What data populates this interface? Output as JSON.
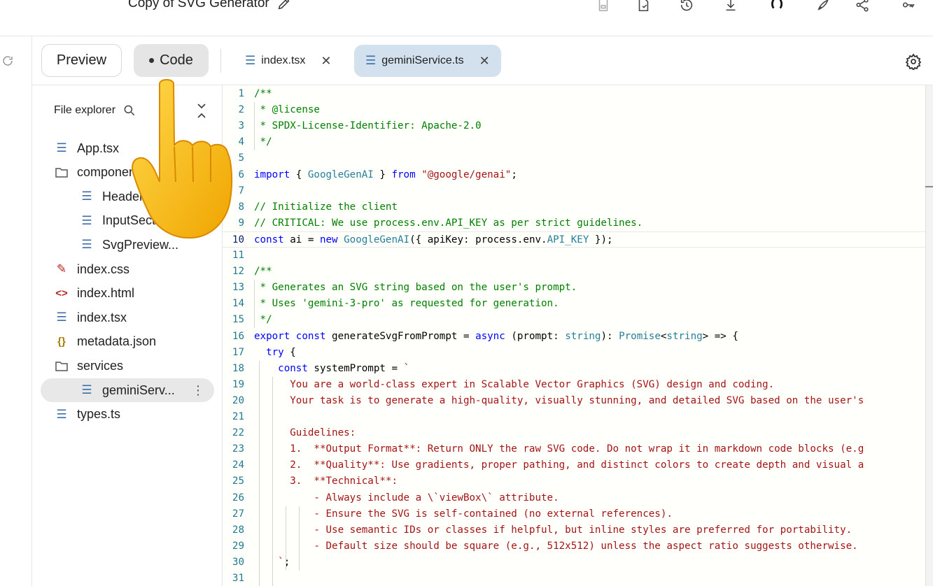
{
  "header": {
    "title": "Copy of SVG Generator",
    "icons": [
      "save-icon",
      "export-file-icon",
      "history-icon",
      "download-icon",
      "github-icon",
      "deploy-icon",
      "share-icon",
      "api-key-icon"
    ]
  },
  "toolbar": {
    "preview_label": "Preview",
    "code_label": "Code",
    "tabs": [
      {
        "label": "index.tsx",
        "active": false
      },
      {
        "label": "geminiService.ts",
        "active": true
      }
    ]
  },
  "explorer": {
    "title": "File explorer",
    "items": [
      {
        "label": "App.tsx",
        "icon": "doc",
        "indent": 0
      },
      {
        "label": "components",
        "icon": "folder",
        "indent": 0
      },
      {
        "label": "Header.tsx",
        "icon": "doc",
        "indent": 1
      },
      {
        "label": "InputSection.tsx",
        "icon": "doc",
        "indent": 1
      },
      {
        "label": "SvgPreview...",
        "icon": "doc",
        "indent": 1
      },
      {
        "label": "index.css",
        "icon": "css",
        "indent": 0
      },
      {
        "label": "index.html",
        "icon": "html",
        "indent": 0
      },
      {
        "label": "index.tsx",
        "icon": "doc",
        "indent": 0
      },
      {
        "label": "metadata.json",
        "icon": "json",
        "indent": 0
      },
      {
        "label": "services",
        "icon": "folder",
        "indent": 0
      },
      {
        "label": "geminiServ...",
        "icon": "doc",
        "indent": 1,
        "selected": true
      },
      {
        "label": "types.ts",
        "icon": "doc",
        "indent": 0
      }
    ]
  },
  "editor": {
    "highlighted_line": 10,
    "lines": [
      [
        [
          "c-com",
          "/**"
        ]
      ],
      [
        [
          "c-com",
          " * @license"
        ]
      ],
      [
        [
          "c-com",
          " * SPDX-License-Identifier: Apache-2.0"
        ]
      ],
      [
        [
          "c-com",
          " */"
        ]
      ],
      [],
      [
        [
          "c-kw",
          "import"
        ],
        [
          "c-plain",
          " { "
        ],
        [
          "c-type",
          "GoogleGenAI"
        ],
        [
          "c-plain",
          " } "
        ],
        [
          "c-kw",
          "from"
        ],
        [
          "c-plain",
          " "
        ],
        [
          "c-str",
          "\"@google/genai\""
        ],
        [
          "c-plain",
          ";"
        ]
      ],
      [],
      [
        [
          "c-com",
          "// Initialize the client"
        ]
      ],
      [
        [
          "c-com",
          "// CRITICAL: We use process.env.API_KEY as per strict guidelines."
        ]
      ],
      [
        [
          "c-kw",
          "const"
        ],
        [
          "c-plain",
          " ai = "
        ],
        [
          "c-kw",
          "new"
        ],
        [
          "c-plain",
          " "
        ],
        [
          "c-type",
          "GoogleGenAI"
        ],
        [
          "c-plain",
          "({ apiKey: process.env."
        ],
        [
          "c-type",
          "API_KEY"
        ],
        [
          "c-plain",
          " });"
        ]
      ],
      [],
      [
        [
          "c-com",
          "/**"
        ]
      ],
      [
        [
          "c-com",
          " * Generates an SVG string based on the user's prompt."
        ]
      ],
      [
        [
          "c-com",
          " * Uses 'gemini-3-pro' as requested for generation."
        ]
      ],
      [
        [
          "c-com",
          " */"
        ]
      ],
      [
        [
          "c-kw",
          "export"
        ],
        [
          "c-plain",
          " "
        ],
        [
          "c-kw",
          "const"
        ],
        [
          "c-plain",
          " generateSvgFromPrompt = "
        ],
        [
          "c-kw",
          "async"
        ],
        [
          "c-plain",
          " (prompt: "
        ],
        [
          "c-type",
          "string"
        ],
        [
          "c-plain",
          "): "
        ],
        [
          "c-type",
          "Promise"
        ],
        [
          "c-plain",
          "<"
        ],
        [
          "c-type",
          "string"
        ],
        [
          "c-plain",
          "> => {"
        ]
      ],
      [
        [
          "c-plain",
          "  "
        ],
        [
          "c-kw",
          "try"
        ],
        [
          "c-plain",
          " {"
        ]
      ],
      [
        [
          "c-plain",
          "    "
        ],
        [
          "c-kw",
          "const"
        ],
        [
          "c-plain",
          " systemPrompt = "
        ],
        [
          "c-str",
          "`"
        ]
      ],
      [
        [
          "c-str",
          "      You are a world-class expert in Scalable Vector Graphics (SVG) design and coding."
        ]
      ],
      [
        [
          "c-str",
          "      Your task is to generate a high-quality, visually stunning, and detailed SVG based on the user's"
        ]
      ],
      [],
      [
        [
          "c-str",
          "      Guidelines:"
        ]
      ],
      [
        [
          "c-str",
          "      1.  **Output Format**: Return ONLY the raw SVG code. Do not wrap it in markdown code blocks (e.g"
        ]
      ],
      [
        [
          "c-str",
          "      2.  **Quality**: Use gradients, proper pathing, and distinct colors to create depth and visual a"
        ]
      ],
      [
        [
          "c-str",
          "      3.  **Technical**:"
        ]
      ],
      [
        [
          "c-str",
          "          - Always include a \\`viewBox\\` attribute."
        ]
      ],
      [
        [
          "c-str",
          "          - Ensure the SVG is self-contained (no external references)."
        ]
      ],
      [
        [
          "c-str",
          "          - Use semantic IDs or classes if helpful, but inline styles are preferred for portability."
        ]
      ],
      [
        [
          "c-str",
          "          - Default size should be square (e.g., 512x512) unless the aspect ratio suggests otherwise."
        ]
      ],
      [
        [
          "c-str",
          "    `"
        ],
        [
          "c-plain",
          ";"
        ]
      ],
      []
    ]
  }
}
